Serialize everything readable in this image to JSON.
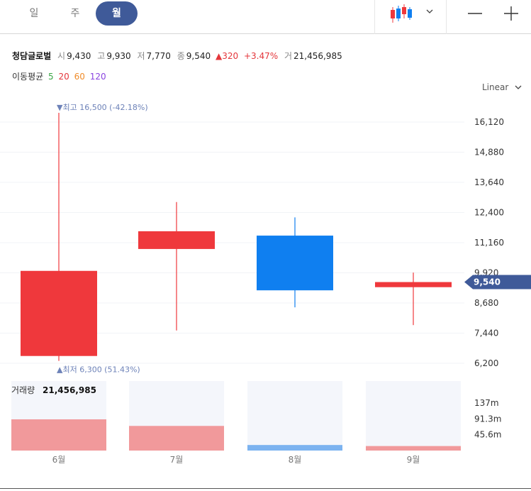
{
  "tabs": [
    {
      "label": "일"
    },
    {
      "label": "주"
    },
    {
      "label": "월"
    }
  ],
  "active_tab": "월",
  "stock": {
    "name": "청담글로벌",
    "open_label": "시",
    "open": "9,430",
    "high_label": "고",
    "high": "9,930",
    "low_label": "저",
    "low": "7,770",
    "close_label": "종",
    "close": "9,540",
    "change": "320",
    "change_pct": "+3.47%",
    "volume_label": "거",
    "volume": "21,456,985"
  },
  "moving_average": {
    "label": "이동평균",
    "periods": [
      {
        "value": "5",
        "color": "#3aa645"
      },
      {
        "value": "20",
        "color": "#e4363b"
      },
      {
        "value": "60",
        "color": "#f08c2a"
      },
      {
        "value": "120",
        "color": "#8a44e0"
      }
    ]
  },
  "scale_mode": "Linear",
  "colors": {
    "up": "#ef383c",
    "down": "#0f7ff0",
    "accent": "#3f5a99",
    "marker": "#6d82b8",
    "volume_up": "#f1999b",
    "volume_down": "#7cb3f0"
  },
  "icons": {
    "chart_type": "candlestick-icon",
    "dropdown": "chevron-down-icon",
    "zoom_out": "minus-icon",
    "zoom_in": "plus-icon"
  },
  "chart_data": {
    "type": "candlestick",
    "categories": [
      "6월",
      "7월",
      "8월",
      "9월"
    ],
    "ohlc": [
      {
        "open": 6500,
        "high": 16500,
        "low": 6300,
        "close": 10000,
        "direction": "up"
      },
      {
        "open": 10900,
        "high": 12830,
        "low": 7550,
        "close": 11630,
        "direction": "up"
      },
      {
        "open": 11450,
        "high": 12200,
        "low": 8500,
        "close": 9200,
        "direction": "down"
      },
      {
        "open": 9330,
        "high": 9930,
        "low": 7770,
        "close": 9540,
        "direction": "up"
      }
    ],
    "y_ticks": [
      "16,120",
      "14,880",
      "13,640",
      "12,400",
      "11,160",
      "9,920",
      "8,680",
      "7,440",
      "6,200"
    ],
    "y_tick_values": [
      16120,
      14880,
      13640,
      12400,
      11160,
      9920,
      8680,
      7440,
      6200
    ],
    "ylim": [
      5700,
      17400
    ],
    "current_price": {
      "value": 9540,
      "label": "9,540"
    },
    "max_marker": {
      "value": 16500,
      "label_prefix": "최고",
      "label": "16,500 (-42.18%)"
    },
    "min_marker": {
      "value": 6300,
      "label_prefix": "최저",
      "label": "6,300 (51.43%)"
    },
    "volume": {
      "label": "거래량",
      "total": "21,456,985",
      "values": [
        90,
        71,
        16,
        13
      ],
      "unit": "m",
      "ticks": [
        "137m",
        "91.3m",
        "45.6m"
      ],
      "tick_values": [
        137,
        91.3,
        45.6
      ],
      "ylim": [
        0,
        137
      ]
    }
  }
}
